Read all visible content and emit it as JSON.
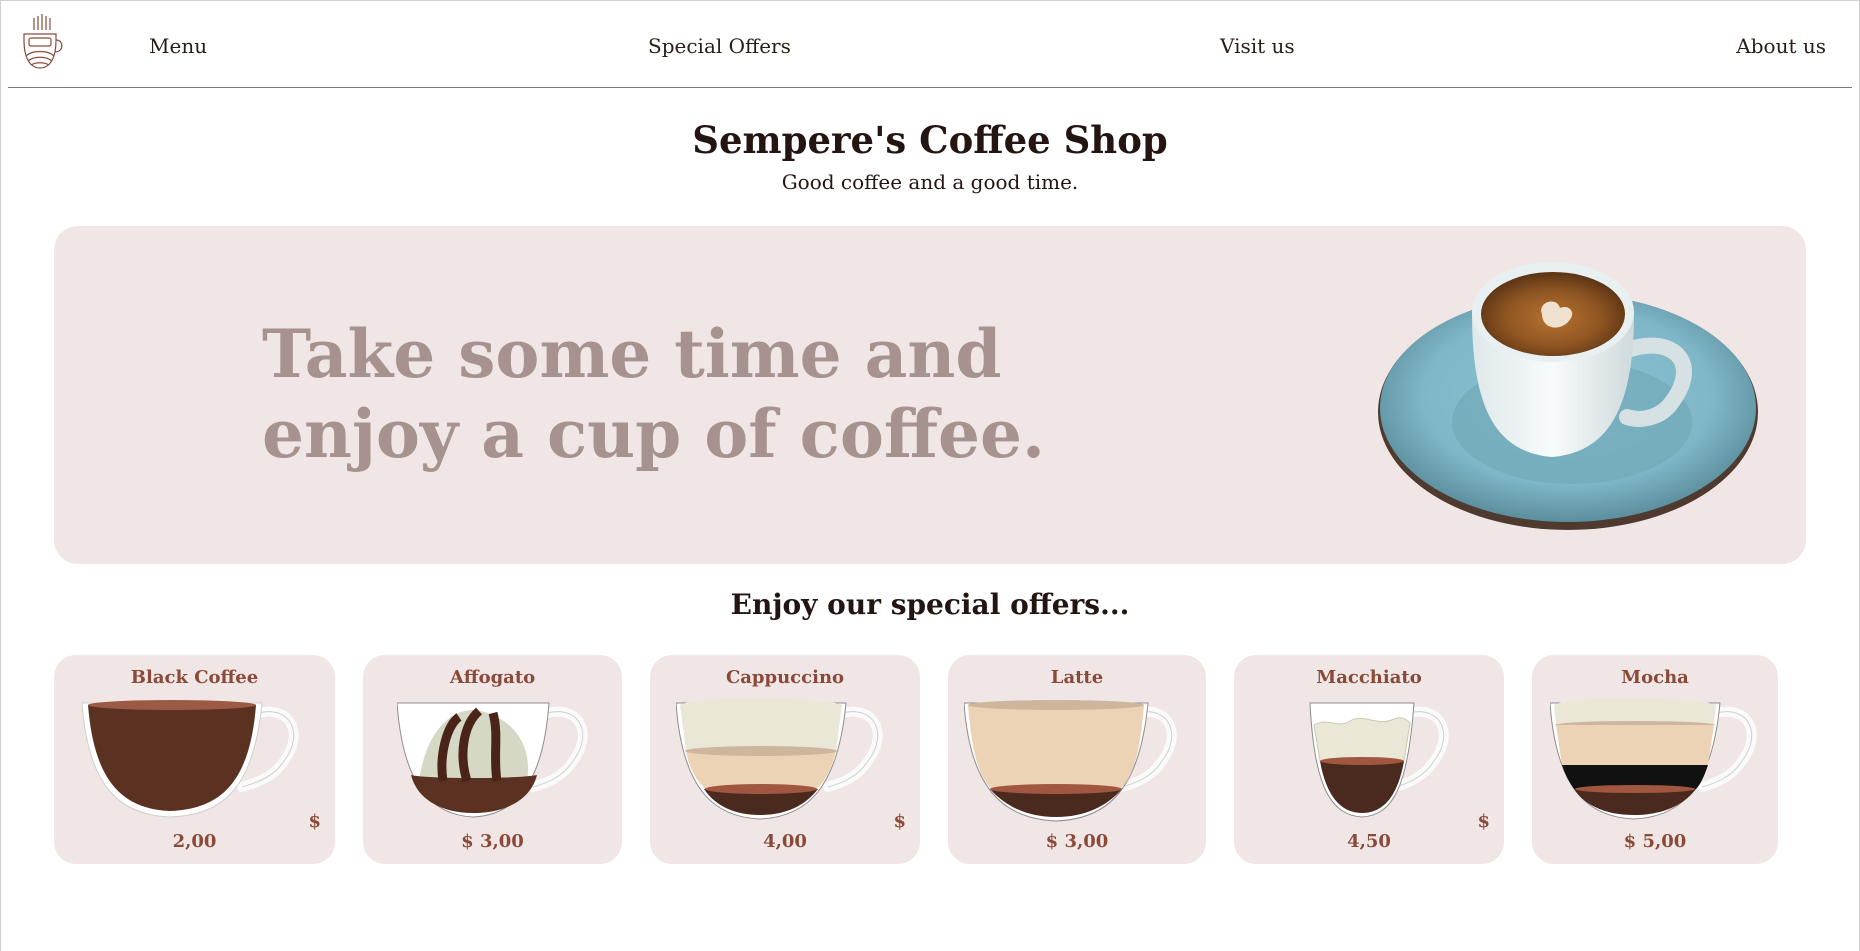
{
  "nav": {
    "logo_icon": "coffee-cup-logo-icon",
    "items": [
      {
        "label": "Menu"
      },
      {
        "label": "Special Offers"
      },
      {
        "label": "Visit us"
      },
      {
        "label": "About us"
      }
    ]
  },
  "header": {
    "title": "Sempere's Coffee Shop",
    "tagline": "Good coffee and a good time."
  },
  "hero": {
    "headline": "Take some time and enjoy a cup of coffee.",
    "image_icon": "coffee-cup-on-saucer-image"
  },
  "offers": {
    "title": "Enjoy our special offers...",
    "items": [
      {
        "name": "Black Coffee",
        "price": "2,00",
        "currency": "$"
      },
      {
        "name": "Affogato",
        "price": "$ 3,00"
      },
      {
        "name": "Cappuccino",
        "price": "4,00",
        "currency": "$"
      },
      {
        "name": "Latte",
        "price": "$ 3,00"
      },
      {
        "name": "Macchiato",
        "price": "4,50",
        "currency": "$"
      },
      {
        "name": "Mocha",
        "price": "$ 5,00"
      }
    ]
  },
  "colors": {
    "accent": "#8a4a3a",
    "hero_bg": "#f0e6e5",
    "hero_text": "#a6938f",
    "coffee_dark": "#4a2a1f",
    "milk": "#ecd3b6",
    "foam": "#ebe7d6"
  }
}
